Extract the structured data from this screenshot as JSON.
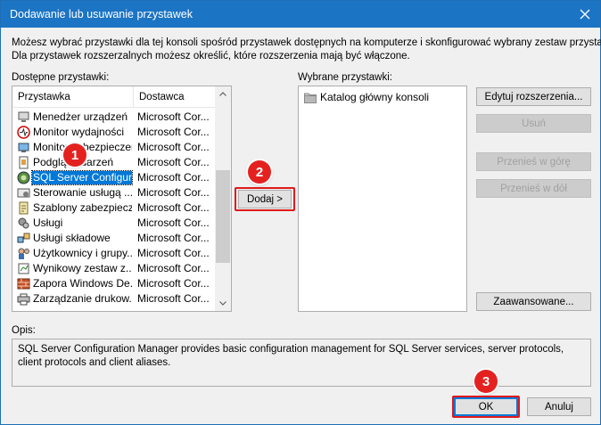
{
  "window": {
    "title": "Dodawanie lub usuwanie przystawek"
  },
  "description": {
    "line1": "Możesz wybrać przystawki dla tej konsoli spośród przystawek dostępnych na komputerze i skonfigurować wybrany zestaw przystawek.",
    "line2": "Dla przystawek rozszerzalnych możesz określić, które rozszerzenia mają być włączone."
  },
  "available": {
    "label": "Dostępne przystawki:",
    "columns": {
      "name": "Przystawka",
      "vendor": "Dostawca"
    },
    "items": [
      {
        "name": "Menedżer urządzeń",
        "vendor": "Microsoft Cor...",
        "icon": "device-manager-icon"
      },
      {
        "name": "Monitor wydajności",
        "vendor": "Microsoft Cor...",
        "icon": "performance-monitor-icon"
      },
      {
        "name": "Monitor zabezpieczeń...",
        "vendor": "Microsoft Cor...",
        "icon": "security-monitor-icon"
      },
      {
        "name": "Podgląd zdarzeń",
        "vendor": "Microsoft Cor...",
        "icon": "event-viewer-icon"
      },
      {
        "name": "SQL Server Configur...",
        "vendor": "Microsoft Cor...",
        "icon": "sql-server-icon",
        "selected": true
      },
      {
        "name": "Sterowanie usługą ...",
        "vendor": "Microsoft Cor...",
        "icon": "service-control-icon"
      },
      {
        "name": "Szablony zabezpieczeń",
        "vendor": "Microsoft Cor...",
        "icon": "security-templates-icon"
      },
      {
        "name": "Usługi",
        "vendor": "Microsoft Cor...",
        "icon": "services-icon"
      },
      {
        "name": "Usługi składowe",
        "vendor": "Microsoft Cor...",
        "icon": "component-services-icon"
      },
      {
        "name": "Użytkownicy i grupy...",
        "vendor": "Microsoft Cor...",
        "icon": "users-groups-icon"
      },
      {
        "name": "Wynikowy zestaw z...",
        "vendor": "Microsoft Cor...",
        "icon": "rsop-icon"
      },
      {
        "name": "Zapora Windows De...",
        "vendor": "Microsoft Cor...",
        "icon": "firewall-icon"
      },
      {
        "name": "Zarządzanie drukow...",
        "vendor": "Microsoft Cor...",
        "icon": "print-management-icon"
      }
    ]
  },
  "add_button": "Dodaj >",
  "selected": {
    "label": "Wybrane przystawki:",
    "items": [
      {
        "name": "Katalog główny konsoli",
        "icon": "folder-icon"
      }
    ]
  },
  "buttons": {
    "edit_extensions": "Edytuj rozszerzenia...",
    "remove": "Usuń",
    "move_up": "Przenieś w górę",
    "move_down": "Przenieś w dół",
    "advanced": "Zaawansowane...",
    "ok": "OK",
    "cancel": "Anuluj"
  },
  "opis": {
    "label": "Opis:",
    "text": "SQL Server Configuration Manager provides basic configuration management for SQL Server services, server protocols, client protocols and client aliases."
  },
  "annotations": {
    "badge1": "1",
    "badge2": "2",
    "badge3": "3",
    "color": "#e32220"
  },
  "colors": {
    "titlebar": "#1c74c4",
    "selection": "#0078d7"
  }
}
